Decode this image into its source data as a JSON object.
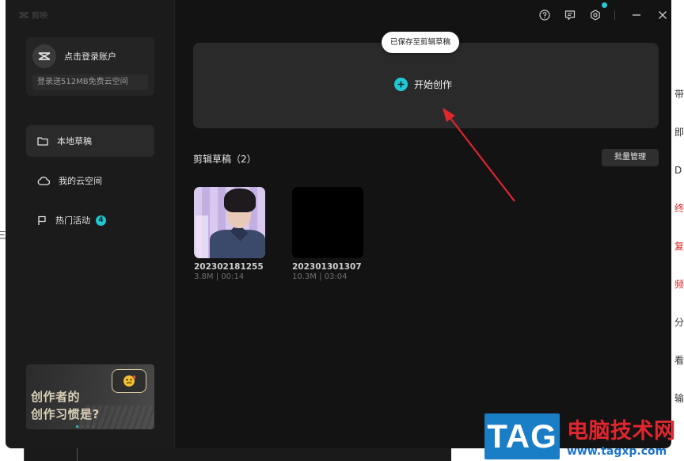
{
  "app": {
    "name": "剪映"
  },
  "account": {
    "login_label": "点击登录账户",
    "cloud_promo": "登录送512MB免费云空间"
  },
  "sidebar": {
    "items": [
      {
        "label": "本地草稿",
        "icon": "folder-icon",
        "active": true
      },
      {
        "label": "我的云空间",
        "icon": "cloud-icon",
        "active": false
      },
      {
        "label": "热门活动",
        "icon": "flag-icon",
        "active": false,
        "badge": "4"
      }
    ]
  },
  "promo": {
    "line1": "创作者的",
    "line2": "创作习惯是?"
  },
  "topbar": {
    "icons": [
      "help-icon",
      "feedback-icon",
      "settings-icon",
      "minimize-icon",
      "close-icon"
    ]
  },
  "main": {
    "toast": "已保存至剪辑草稿",
    "create_label": "开始创作",
    "drafts_title": "剪辑草稿（2）",
    "batch_label": "批量管理",
    "drafts": [
      {
        "name": "202302181255",
        "meta": "3.8M | 00:14"
      },
      {
        "name": "202301301307",
        "meta": "10.3M | 03:04"
      }
    ]
  },
  "colors": {
    "accent": "#20c8d3",
    "annotation": "#e0262e"
  },
  "watermark": {
    "logo": "TAG",
    "title": "电脑技术网",
    "url": "www.tagxp.com"
  },
  "background": {
    "left_chars": [
      "三"
    ],
    "right_chars": [
      "带",
      "即",
      "D",
      "终",
      "复",
      "频",
      "分",
      "看",
      "输"
    ]
  }
}
